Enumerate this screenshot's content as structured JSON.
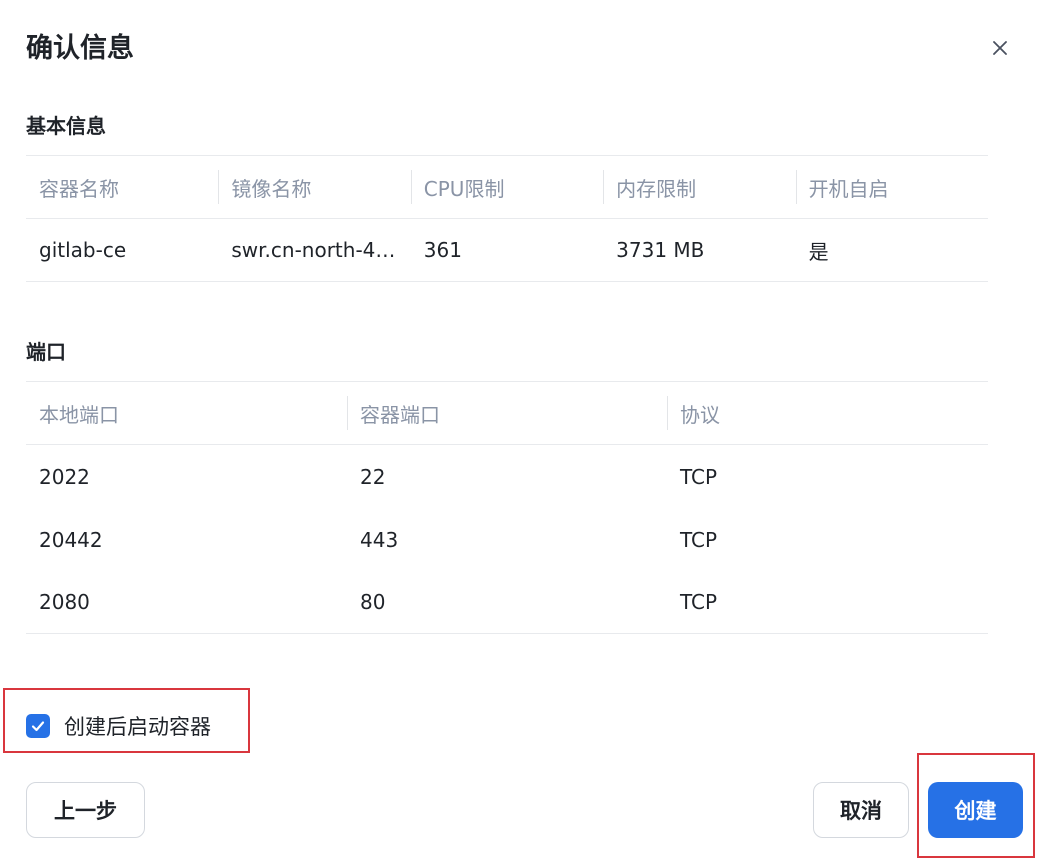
{
  "dialog": {
    "title": "确认信息"
  },
  "basic_info": {
    "section_title": "基本信息",
    "columns": [
      "容器名称",
      "镜像名称",
      "CPU限制",
      "内存限制",
      "开机自启"
    ],
    "rows": [
      [
        "gitlab-ce",
        "swr.cn-north-4....",
        "361",
        "3731 MB",
        "是"
      ]
    ]
  },
  "ports": {
    "section_title": "端口",
    "columns": [
      "本地端口",
      "容器端口",
      "协议"
    ],
    "rows": [
      [
        "2022",
        "22",
        "TCP"
      ],
      [
        "20442",
        "443",
        "TCP"
      ],
      [
        "2080",
        "80",
        "TCP"
      ]
    ]
  },
  "start_after_create": {
    "label": "创建后启动容器",
    "checked": true
  },
  "footer": {
    "prev_label": "上一步",
    "cancel_label": "取消",
    "create_label": "创建"
  },
  "colors": {
    "accent": "#2671e6",
    "highlight_border": "#d9363e",
    "header_text": "#8a94a6"
  },
  "icons": {
    "close": "close-icon",
    "check": "check-icon"
  }
}
